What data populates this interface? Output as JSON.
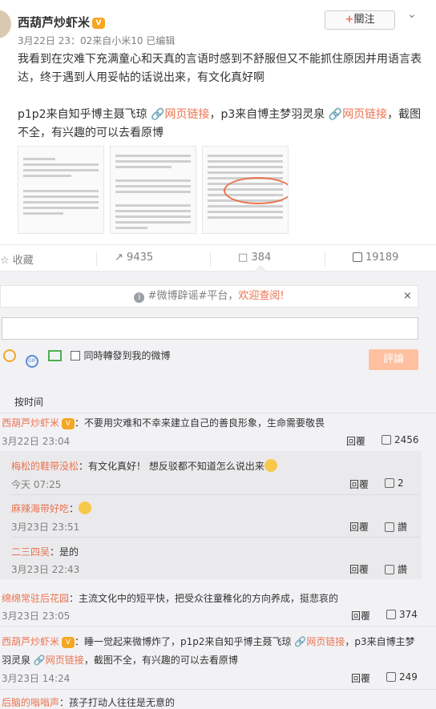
{
  "post": {
    "author": "西葫芦炒虾米",
    "follow_label": "關注",
    "meta": "3月22日 23：02来自小米10  已编辑",
    "body_line1": "我看到在灾难下充满童心和天真的言语时感到不舒服但又不能抓住原因并用语言表达，终于遇到人用妥帖的话说出来，有文化真好啊",
    "body_line2a": "p1p2来自知乎博主聂飞琼",
    "body_link1": "网页链接",
    "body_line2b": "，p3来自博主梦羽灵泉",
    "body_link2": "网页链接",
    "body_line2c": "，截图不全，有兴趣的可以去看原博"
  },
  "actions": {
    "favorite": "收藏",
    "repost": "9435",
    "comments": "384",
    "likes": "19189"
  },
  "notice": {
    "prefix": "#微博辟谣#平台，",
    "highlight": "欢迎查阅!",
    "close": "×"
  },
  "composer": {
    "repost_checkbox_label": "同時轉發到我的微博",
    "submit_label": "評論"
  },
  "sort_label": "按时间",
  "comments": [
    {
      "name": "西葫芦炒虾米",
      "text": "：不要用灾难和不幸来建立自己的善良形象，生命需要敬畏",
      "date": "3月22日 23:04",
      "reply": "回覆",
      "likes": "2456"
    },
    {
      "name": "梅松的鞋带没松",
      "text": "：有文化真好！ 想反驳都不知道怎么说出来",
      "date": "今天 07:25",
      "reply": "回覆",
      "likes": "2"
    },
    {
      "name": "麻辣海带好吃",
      "text": "：",
      "date": "3月23日 23:51",
      "reply": "回覆",
      "likes": "讚"
    },
    {
      "name": "二三四吴",
      "text": "：是的",
      "date": "3月23日 22:43",
      "reply": "回覆",
      "likes": "讚"
    },
    {
      "name": "绵绵常驻后花园",
      "text": "：主流文化中的短平快，把受众往童稚化的方向养成，挺悲哀的",
      "date": "3月23日 23:05",
      "reply": "回覆",
      "likes": "374"
    },
    {
      "name": "西葫芦炒虾米",
      "text_a": "：睡一觉起来微博炸了，p1p2来自知乎博主聂飞琼",
      "link1": "网页链接",
      "text_b": "，p3来自博主梦",
      "text_c": "羽灵泉",
      "link2": "网页链接",
      "text_d": "，截图不全，有兴趣的可以去看原博",
      "date": "3月23日 14:24",
      "reply": "回覆",
      "likes": "249"
    },
    {
      "name": "后脑的嗡嗡声",
      "text": "：孩子打动人往往是无意的"
    }
  ],
  "colors": {
    "accent": "#eb7350",
    "submit_bg": "#ffc09f",
    "panel_bg": "#f2f2f5"
  }
}
